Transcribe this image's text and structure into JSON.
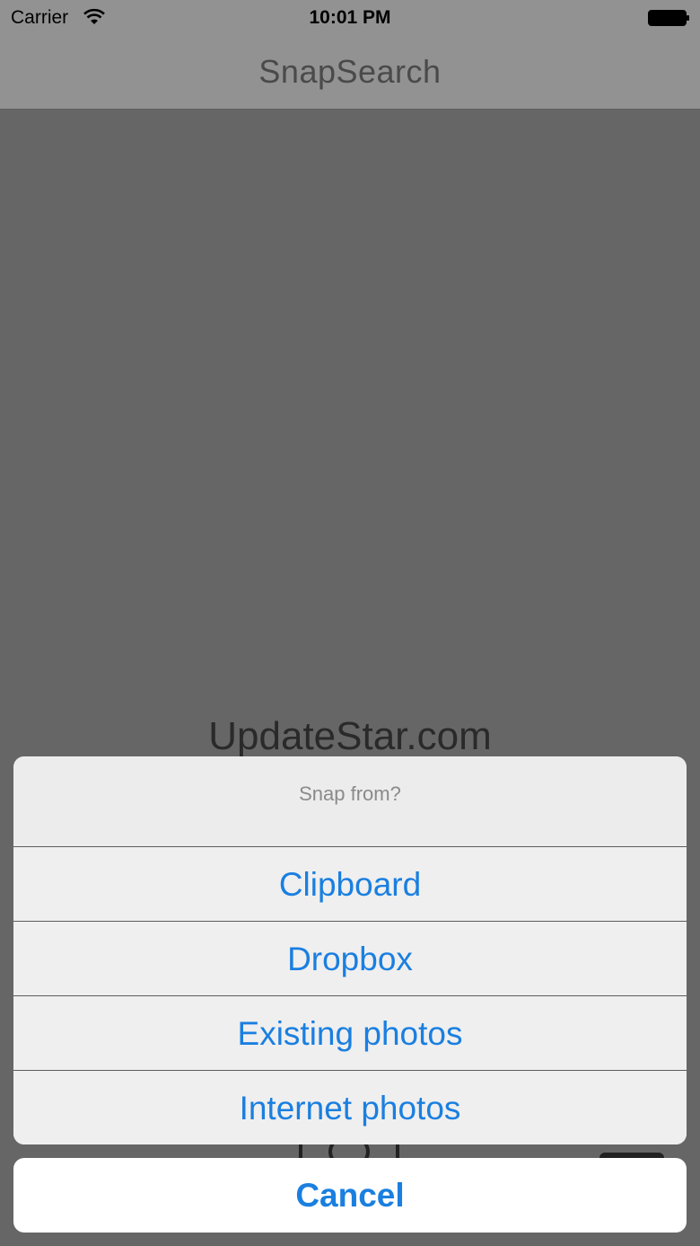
{
  "status_bar": {
    "carrier": "Carrier",
    "time": "10:01 PM",
    "wifi_icon": "wifi-icon",
    "battery_icon": "battery-icon"
  },
  "nav_bar": {
    "title": "SnapSearch"
  },
  "content": {
    "watermark": "UpdateStar.com"
  },
  "action_sheet": {
    "title": "Snap from?",
    "options": [
      {
        "label": "Clipboard"
      },
      {
        "label": "Dropbox"
      },
      {
        "label": "Existing photos"
      },
      {
        "label": "Internet photos"
      }
    ],
    "cancel_label": "Cancel"
  },
  "colors": {
    "accent": "#1a7fe0",
    "dim_overlay": "#666666",
    "nav_bar": "#929292"
  }
}
